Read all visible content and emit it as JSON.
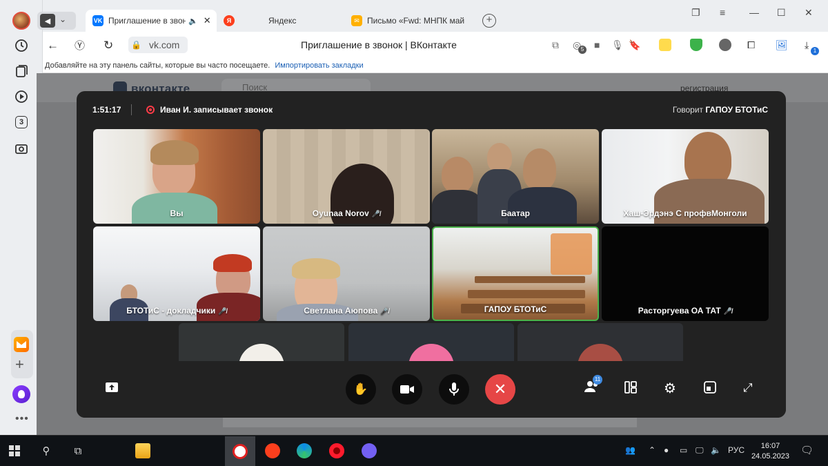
{
  "browser": {
    "tabs": [
      {
        "label": "Приглашение в звонок",
        "favicon": "vk",
        "active": true
      },
      {
        "label": "Яндекс",
        "favicon": "yandex",
        "active": false
      },
      {
        "label": "Письмо «Fwd: МНПК май",
        "favicon": "mail",
        "active": false
      }
    ],
    "domain": "vk.com",
    "page_title": "Приглашение в звонок | ВКонтакте",
    "bookmarks_hint": "Добавляйте на эту панель сайты, которые вы часто посещаете.",
    "bookmarks_link": "Импортировать закладки",
    "rail_counter": "3",
    "ext_badge": "1",
    "ext_counter": "5"
  },
  "vk_page": {
    "logo": "вконтакте",
    "search_placeholder": "Поиск",
    "register_link": "регистрация"
  },
  "call": {
    "timer": "1:51:17",
    "recording_text": "Иван И. записывает звонок",
    "speaking_label": "Говорит",
    "speaking_name": "ГАПОУ БТОТиС",
    "participants_count": "11",
    "tiles": [
      {
        "name": "Вы",
        "muted": false
      },
      {
        "name": "Oyunaa Norov",
        "muted": true
      },
      {
        "name": "Баатар",
        "muted": false
      },
      {
        "name": "Хаш-Эрдэнэ С профвМонголи",
        "muted": false
      },
      {
        "name": "БТОТиС - докладчики",
        "muted": true
      },
      {
        "name": "Светлана Аюпова",
        "muted": true
      },
      {
        "name": "ГАПОУ БТОТиС",
        "muted": false,
        "active": true
      },
      {
        "name": "Расторгуева ОА ТАТ",
        "muted": true
      }
    ],
    "colors": {
      "end_call": "#e64646",
      "active_border": "#4bb34b",
      "recording": "#ff3b47"
    }
  },
  "taskbar": {
    "language": "РУС",
    "time": "16:07",
    "date": "24.05.2023"
  }
}
